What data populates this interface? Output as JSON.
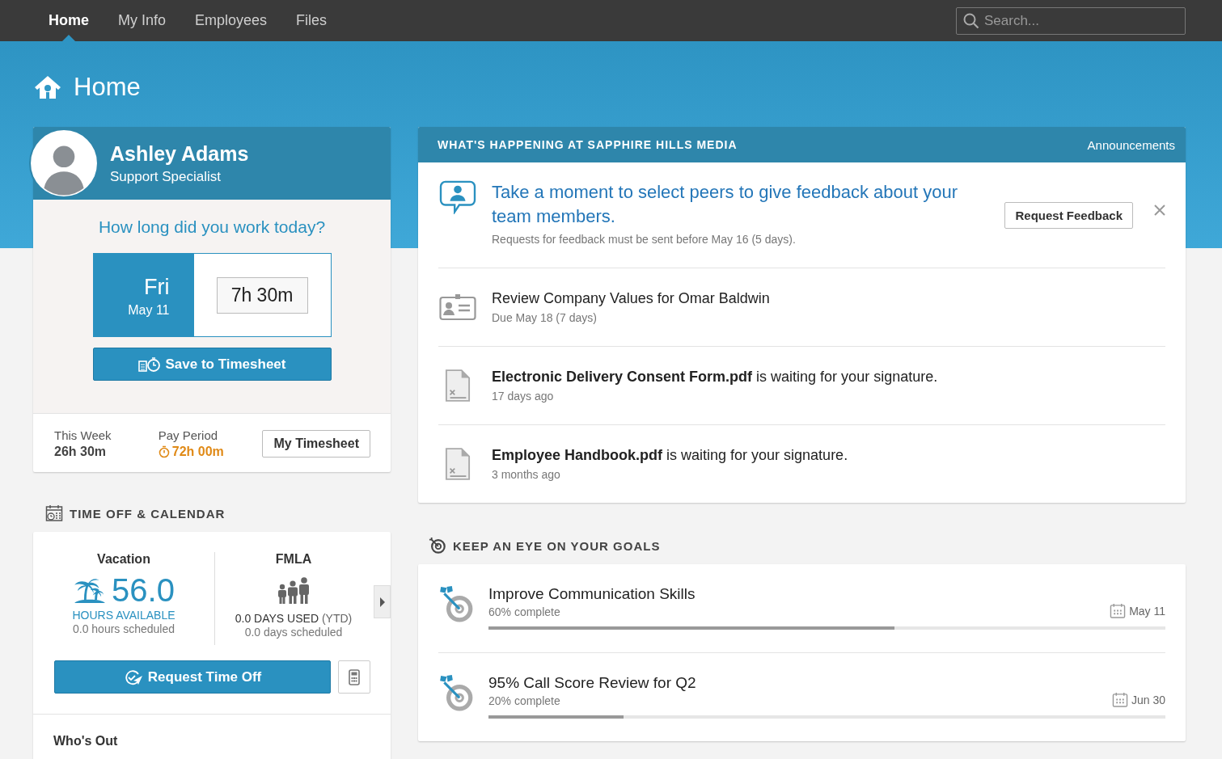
{
  "nav": {
    "tabs": [
      {
        "label": "Home",
        "selected": true
      },
      {
        "label": "My Info",
        "selected": false
      },
      {
        "label": "Employees",
        "selected": false
      },
      {
        "label": "Files",
        "selected": false
      }
    ],
    "search": {
      "placeholder": "Search..."
    }
  },
  "page_title": "Home",
  "profile": {
    "name": "Ashley Adams",
    "title": "Support Specialist"
  },
  "timesheet": {
    "question": "How long did you work today?",
    "day": "Fri",
    "date": "May 11",
    "hours_value": "7h 30m",
    "save_button": "Save to Timesheet",
    "this_week": {
      "label": "This Week",
      "value": "26h 30m"
    },
    "pay_period": {
      "label": "Pay Period",
      "value": "72h 00m"
    },
    "my_timesheet_button": "My Timesheet"
  },
  "time_off": {
    "heading": "TIME OFF & CALENDAR",
    "balances": [
      {
        "kind": "hours",
        "name": "Vacation",
        "amount": "56.0",
        "unit": "HOURS AVAILABLE",
        "scheduled": "0.0 hours scheduled"
      },
      {
        "kind": "days",
        "name": "FMLA",
        "used": "0.0 DAYS USED",
        "used_note": "(YTD)",
        "scheduled": "0.0 days scheduled"
      }
    ],
    "request_button": "Request Time Off",
    "whos_out": "Who's Out"
  },
  "announcements": {
    "heading": "WHAT'S HAPPENING AT SAPPHIRE HILLS MEDIA",
    "link": "Announcements",
    "items": [
      {
        "kind": "feedback",
        "title": "Take a moment to select peers to give feedback about your team members.",
        "note": "Requests for feedback must be sent before May 16 (5 days).",
        "button": "Request Feedback"
      },
      {
        "kind": "task",
        "title": "Review Company Values for Omar Baldwin",
        "note": "Due May 18 (7 days)"
      },
      {
        "kind": "signature",
        "title": "**Electronic Delivery Consent Form.pdf** is waiting for your signature.",
        "note": "17 days ago"
      },
      {
        "kind": "signature",
        "title": "**Employee Handbook.pdf** is waiting for your signature.",
        "note": "3 months ago"
      }
    ]
  },
  "goals": {
    "heading": "KEEP AN EYE ON YOUR GOALS",
    "items": [
      {
        "title": "Improve Communication Skills",
        "progress": "60% complete",
        "level": 0.6,
        "due": "May 11"
      },
      {
        "title": "95% Call Score Review for Q2",
        "progress": "20% complete",
        "level": 0.2,
        "due": "Jun 30"
      }
    ]
  }
}
